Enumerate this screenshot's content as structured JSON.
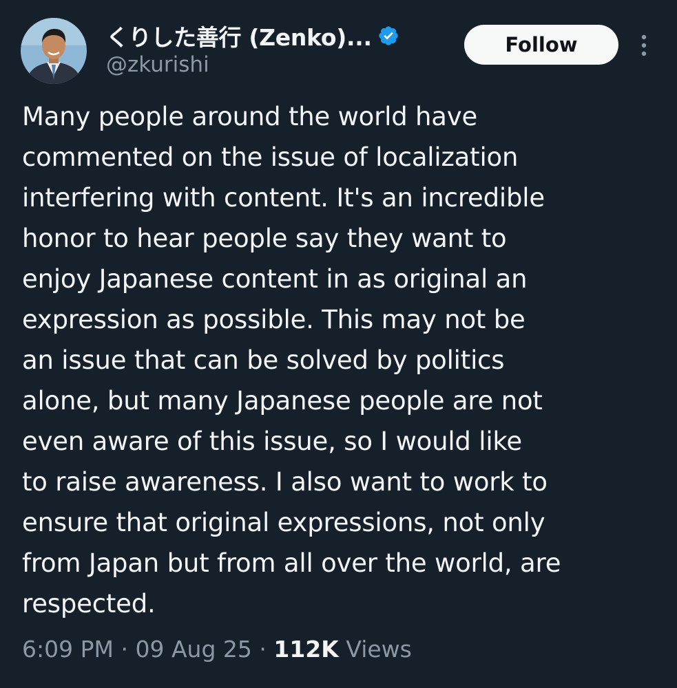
{
  "author": {
    "display_name": "くりした善行 (Zenko)...",
    "handle": "@zkurishi",
    "verified": true,
    "avatar_icon": "profile-photo-man-in-suit"
  },
  "actions": {
    "follow_label": "Follow",
    "more_icon": "vertical-ellipsis-icon"
  },
  "tweet": {
    "lines": [
      "Many people around the world have",
      "commented on the issue of localization",
      "interfering with content. It's an incredible",
      "honor to hear people say they want to",
      "enjoy Japanese content in as original an",
      "expression as possible. This may not be",
      "an issue that can be solved by politics",
      "alone, but many Japanese people are not",
      "even aware of this issue, so I would like",
      "to raise awareness. I also want to work to",
      "ensure that original expressions, not only",
      "from Japan but from all over the world, are",
      "respected."
    ]
  },
  "meta": {
    "time": "6:09 PM",
    "separator": "·",
    "date": "09 Aug 25",
    "views_count": "112K",
    "views_label": "Views"
  },
  "colors": {
    "background": "#16202b",
    "text": "#f3f5f7",
    "secondary": "#8b98a5",
    "verified_badge": "#1d9bf0",
    "follow_bg": "#f7f9f9"
  }
}
